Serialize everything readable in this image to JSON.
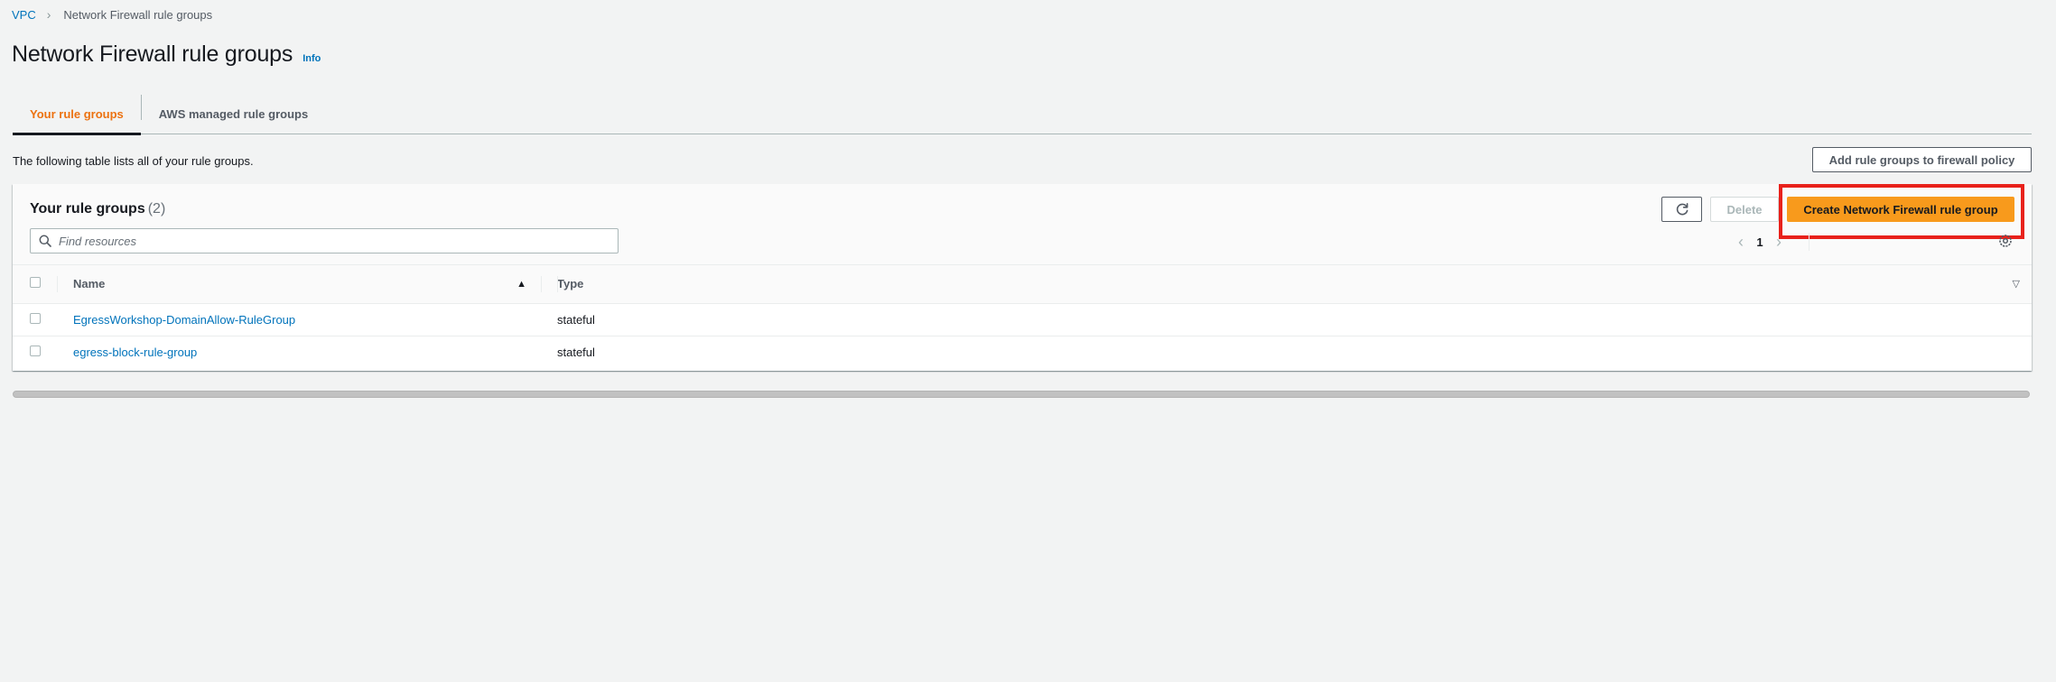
{
  "breadcrumb": {
    "root": "VPC",
    "current": "Network Firewall rule groups"
  },
  "page": {
    "title": "Network Firewall rule groups",
    "info": "Info"
  },
  "tabs": [
    {
      "label": "Your rule groups",
      "active": true
    },
    {
      "label": "AWS managed rule groups",
      "active": false
    }
  ],
  "description": "The following table lists all of your rule groups.",
  "add_button": "Add rule groups to firewall policy",
  "container": {
    "title": "Your rule groups",
    "count": "(2)",
    "delete_label": "Delete",
    "create_label": "Create Network Firewall rule group",
    "search_placeholder": "Find resources",
    "page_number": "1"
  },
  "table": {
    "columns": [
      "Name",
      "Type"
    ],
    "rows": [
      {
        "name": "EgressWorkshop-DomainAllow-RuleGroup",
        "type": "stateful"
      },
      {
        "name": "egress-block-rule-group",
        "type": "stateful"
      }
    ]
  },
  "colors": {
    "accent": "#ec7211",
    "link": "#0073bb",
    "primary_button": "#f89a1c",
    "highlight": "#e8211b"
  },
  "icons": {
    "refresh": "refresh-icon",
    "search": "search-icon",
    "settings": "gear-icon",
    "sort": "sort-ascending-icon",
    "filter": "filter-caret-icon"
  }
}
